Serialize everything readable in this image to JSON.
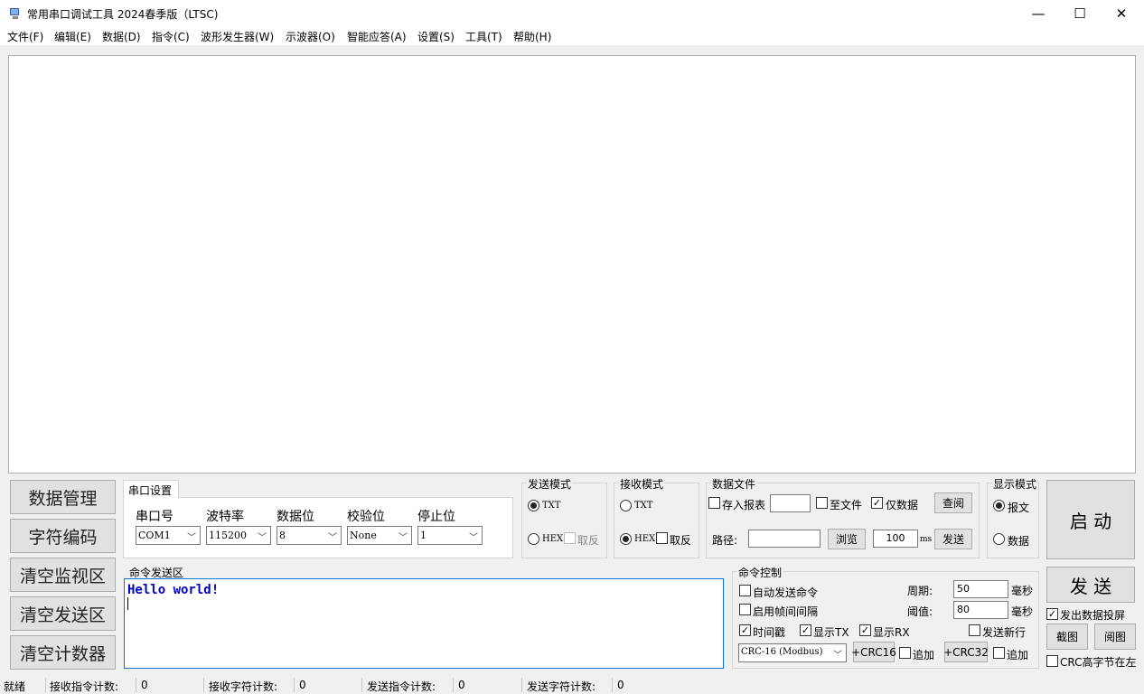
{
  "window": {
    "title": "常用串口调试工具 2024春季版（LTSC)",
    "minimize": "—",
    "maximize": "☐",
    "close": "✕"
  },
  "menu": [
    "文件(F)",
    "编辑(E)",
    "数据(D)",
    "指令(C)",
    "波形发生器(W)",
    "示波器(O)",
    "智能应答(A)",
    "设置(S)",
    "工具(T)",
    "帮助(H)"
  ],
  "left_buttons": [
    "数据管理",
    "字符编码",
    "清空监视区",
    "清空发送区",
    "清空计数器"
  ],
  "serial": {
    "tab": "串口设置",
    "port_label": "串口号",
    "port_value": "COM1",
    "baud_label": "波特率",
    "baud_value": "115200",
    "databits_label": "数据位",
    "databits_value": "8",
    "parity_label": "校验位",
    "parity_value": "None",
    "stopbits_label": "停止位",
    "stopbits_value": "1"
  },
  "send_mode": {
    "title": "发送模式",
    "txt": "TXT",
    "hex": "HEX",
    "invert": "取反",
    "selected": "TXT"
  },
  "recv_mode": {
    "title": "接收模式",
    "txt": "TXT",
    "hex": "HEX",
    "invert": "取反",
    "selected": "HEX"
  },
  "data_file": {
    "title": "数据文件",
    "save_report": "存入报表",
    "to_file": "至文件",
    "data_only": "仅数据",
    "query": "查阅",
    "path_label": "路径:",
    "path_value": "",
    "browse": "浏览",
    "interval": "100",
    "interval_unit": "ms",
    "send": "发送"
  },
  "display_mode": {
    "title": "显示模式",
    "report": "报文",
    "data": "数据",
    "selected": "报文"
  },
  "start_button": "启 动",
  "send_button": "发 送",
  "command_area": {
    "title": "命令发送区",
    "text": "Hello world!"
  },
  "cmd_control": {
    "title": "命令控制",
    "auto_send": "自动发送命令",
    "frame_interval": "启用帧间间隔",
    "period_label": "周期:",
    "period_value": "50",
    "period_unit": "毫秒",
    "threshold_label": "阈值:",
    "threshold_value": "80",
    "threshold_unit": "毫秒",
    "timestamp": "时间戳",
    "show_tx": "显示TX",
    "show_rx": "显示RX",
    "send_newline": "发送新行",
    "crc_type": "CRC-16 (Modbus)",
    "crc16": "+CRC16",
    "append1": "追加",
    "crc32": "+CRC32",
    "append2": "追加"
  },
  "right_panel": {
    "echo": "发出数据投屏",
    "screenshot": "截图",
    "view_image": "阅图",
    "crc_high": "CRC高字节在左"
  },
  "status": {
    "ready": "就绪",
    "recv_cmd_label": "接收指令计数:",
    "recv_cmd_value": "0",
    "recv_char_label": "接收字符计数:",
    "recv_char_value": "0",
    "send_cmd_label": "发送指令计数:",
    "send_cmd_value": "0",
    "send_char_label": "发送字符计数:",
    "send_char_value": "0"
  },
  "colors": {
    "command_text": "#0000cc",
    "window_bg": "#f0f0f0"
  }
}
